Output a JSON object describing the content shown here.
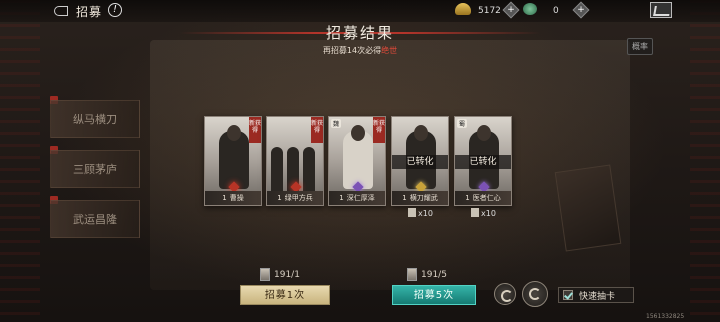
{
  "topbar": {
    "title": "招募",
    "info_symbol": "!",
    "currency_gold": "5172",
    "currency_jade": "0"
  },
  "header": {
    "title": "招募结果",
    "subtitle_prefix": "再招募14次必得",
    "subtitle_highlight": "绝世"
  },
  "side_panel": {
    "cover_tag": "概率",
    "items": [
      "纵马横刀",
      "三顾茅庐",
      "武运昌隆"
    ]
  },
  "cards": [
    {
      "cost": "1",
      "name": "曹操",
      "faction": "",
      "tag": "新获得",
      "status": "",
      "gem": "red",
      "quantity": ""
    },
    {
      "cost": "1",
      "name": "绿甲方兵",
      "faction": "",
      "tag": "新获得",
      "status": "",
      "gem": "red",
      "quantity": ""
    },
    {
      "cost": "1",
      "name": "深仁厚泽",
      "faction": "魏",
      "tag": "新获得",
      "status": "",
      "gem": "purple",
      "quantity": ""
    },
    {
      "cost": "1",
      "name": "横刀耀武",
      "faction": "",
      "tag": "",
      "status": "已转化",
      "gem": "gold",
      "quantity": "x10"
    },
    {
      "cost": "1",
      "name": "医者仁心",
      "faction": "蜀",
      "tag": "",
      "status": "已转化",
      "gem": "purple",
      "quantity": "x10"
    }
  ],
  "bottom": {
    "once_token_count": "191/1",
    "once_button": "招募1次",
    "five_token_count": "191/5",
    "five_button": "招募5次",
    "quick_label": "快速抽卡",
    "uid": "1561332825"
  },
  "colors": {
    "accent_red": "#e24a3a",
    "teal_button": "#1a8a80",
    "gold_button": "#dcc995"
  }
}
